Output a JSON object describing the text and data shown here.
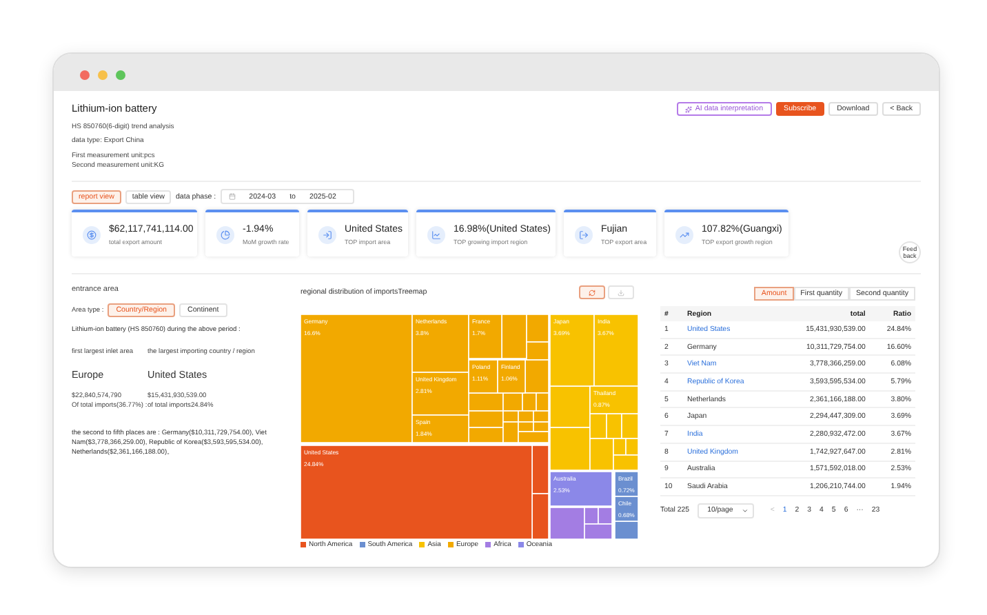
{
  "header": {
    "title": "Lithium-ion battery",
    "subtitle": "HS 850760(6-digit) trend analysis",
    "data_type": "data type:   Export China",
    "unit_1": "First measurement unit:pcs",
    "unit_2": "Second measurement unit:KG"
  },
  "actions": [
    {
      "label": "AI data interpretation",
      "kind": "ai"
    },
    {
      "label": "Subscribe",
      "kind": "primary"
    },
    {
      "label": "Download",
      "kind": "plain"
    },
    {
      "label": "< Back",
      "kind": "plain"
    }
  ],
  "views": [
    {
      "label": "report view",
      "selected": true
    },
    {
      "label": "table view",
      "selected": false
    }
  ],
  "data_phase": {
    "label": "data phase :",
    "from": "2024-03",
    "sep": "to",
    "to": "2025-02"
  },
  "kpis": [
    {
      "value": "$62,117,741,114.00",
      "label": "total export amount"
    },
    {
      "value": "-1.94%",
      "label": "MoM growth rate"
    },
    {
      "value": "United States",
      "label": "TOP import area"
    },
    {
      "value": "16.98%(United States)",
      "label": "TOP growing import region"
    },
    {
      "value": "Fujian",
      "label": "TOP export area"
    },
    {
      "value": "107.82%(Guangxi)",
      "label": "TOP export growth region"
    }
  ],
  "feedback": "Feed back",
  "entrance": {
    "title": "entrance area",
    "area_type": "Area type :",
    "tabs": [
      {
        "label": "Country/Region",
        "selected": true
      },
      {
        "label": "Continent",
        "selected": false
      }
    ],
    "intro": "Lithium-ion battery (HS 850760) during the above period :",
    "columns": [
      {
        "heading": "first largest inlet area",
        "name": "Europe",
        "amount": "$22,840,574,790",
        "share": "Of total imports(36.77%) :"
      },
      {
        "heading": "the largest importing country / region",
        "name": "United States",
        "amount": "$15,431,930,539.00",
        "share": "of total imports24.84%"
      }
    ],
    "others": "the second to fifth places are :     Germany($10,311,729,754.00),   Viet Nam($3,778,366,259.00),   Republic of Korea($3,593,595,534.00),   Netherlands($2,361,166,188.00)。"
  },
  "treemap": {
    "title": "regional distribution of importsTreemap",
    "tiles": [
      {
        "label": "Germany",
        "value": "16.6%",
        "color": "#f2a900"
      },
      {
        "label": "Netherlands",
        "value": "3.8%",
        "color": "#f2a900"
      },
      {
        "label": "United Kingdom",
        "value": "2.81%",
        "color": "#f2a900"
      },
      {
        "label": "Spain",
        "value": "1.84%",
        "color": "#f2a900"
      },
      {
        "label": "France",
        "value": "1.7%",
        "color": "#f2a900"
      },
      {
        "label": "Poland",
        "value": "1.11%",
        "color": "#f2a900"
      },
      {
        "label": "Finland",
        "value": "1.06%",
        "color": "#f2a900"
      },
      {
        "label": "United States",
        "value": "24.84%",
        "color": "#e8541e"
      },
      {
        "label": "Japan",
        "value": "3.69%",
        "color": "#f8c200"
      },
      {
        "label": "India",
        "value": "3.67%",
        "color": "#f8c200"
      },
      {
        "label": "Thailand",
        "value": "0.87%",
        "color": "#f8c200"
      },
      {
        "label": "Australia",
        "value": "2.53%",
        "color": "#8b88e8"
      },
      {
        "label": "Brazil",
        "value": "0.72%",
        "color": "#6b8fd0"
      },
      {
        "label": "Chile",
        "value": "0.68%",
        "color": "#6b8fd0"
      }
    ],
    "legend": [
      {
        "label": "North America",
        "color": "#e8541e"
      },
      {
        "label": "South America",
        "color": "#6b8fd0"
      },
      {
        "label": "Asia",
        "color": "#f8c200"
      },
      {
        "label": "Europe",
        "color": "#f2a900"
      },
      {
        "label": "Africa",
        "color": "#a37de3"
      },
      {
        "label": "Oceania",
        "color": "#8b88e8"
      }
    ]
  },
  "measures": [
    {
      "label": "Amount",
      "selected": true
    },
    {
      "label": "First quantity",
      "selected": false
    },
    {
      "label": "Second quantity",
      "selected": false
    }
  ],
  "table": {
    "columns": [
      "#",
      "Region",
      "total",
      "Ratio"
    ],
    "rows": [
      {
        "n": "1",
        "region": "United States",
        "link": true,
        "total": "15,431,930,539.00",
        "ratio": "24.84%"
      },
      {
        "n": "2",
        "region": "Germany",
        "link": false,
        "total": "10,311,729,754.00",
        "ratio": "16.60%"
      },
      {
        "n": "3",
        "region": "Viet Nam",
        "link": true,
        "total": "3,778,366,259.00",
        "ratio": "6.08%"
      },
      {
        "n": "4",
        "region": "Republic of Korea",
        "link": true,
        "total": "3,593,595,534.00",
        "ratio": "5.79%"
      },
      {
        "n": "5",
        "region": "Netherlands",
        "link": false,
        "total": "2,361,166,188.00",
        "ratio": "3.80%"
      },
      {
        "n": "6",
        "region": "Japan",
        "link": false,
        "total": "2,294,447,309.00",
        "ratio": "3.69%"
      },
      {
        "n": "7",
        "region": "India",
        "link": true,
        "total": "2,280,932,472.00",
        "ratio": "3.67%"
      },
      {
        "n": "8",
        "region": "United Kingdom",
        "link": true,
        "total": "1,742,927,647.00",
        "ratio": "2.81%"
      },
      {
        "n": "9",
        "region": "Australia",
        "link": false,
        "total": "1,571,592,018.00",
        "ratio": "2.53%"
      },
      {
        "n": "10",
        "region": "Saudi Arabia",
        "link": false,
        "total": "1,206,210,744.00",
        "ratio": "1.94%"
      }
    ]
  },
  "pagination": {
    "total": "Total 225",
    "page_size": "10/page",
    "prev": "<",
    "pages": [
      {
        "label": "1",
        "selected": true
      },
      {
        "label": "2",
        "selected": false
      },
      {
        "label": "3",
        "selected": false
      },
      {
        "label": "4",
        "selected": false
      },
      {
        "label": "5",
        "selected": false
      },
      {
        "label": "6",
        "selected": false
      },
      {
        "label": "···",
        "selected": false
      },
      {
        "label": "23",
        "selected": false
      }
    ]
  }
}
